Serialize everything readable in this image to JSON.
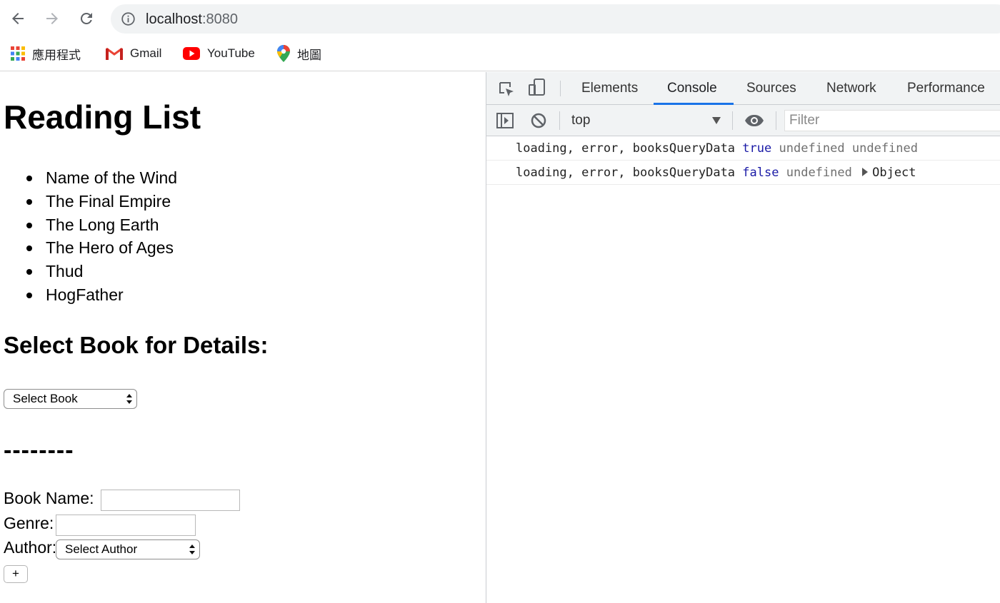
{
  "browser": {
    "url_host": "localhost",
    "url_port": ":8080",
    "bookmarks": [
      {
        "label": "應用程式",
        "icon": "apps-grid-icon"
      },
      {
        "label": "Gmail",
        "icon": "gmail-icon"
      },
      {
        "label": "YouTube",
        "icon": "youtube-icon"
      },
      {
        "label": "地圖",
        "icon": "maps-pin-icon"
      }
    ]
  },
  "page": {
    "title": "Reading List",
    "books": [
      "Name of the Wind",
      "The Final Empire",
      "The Long Earth",
      "The Hero of Ages",
      "Thud",
      "HogFather"
    ],
    "details_heading": "Select Book for Details:",
    "book_select_value": "Select Book",
    "divider_text": "--------",
    "form": {
      "book_name_label": "Book Name:",
      "book_name_value": "",
      "genre_label": "Genre:",
      "genre_value": "",
      "author_label": "Author:",
      "author_select_value": "Select Author",
      "add_button_label": "+"
    }
  },
  "devtools": {
    "tabs": [
      {
        "label": "Elements",
        "active": false
      },
      {
        "label": "Console",
        "active": true
      },
      {
        "label": "Sources",
        "active": false
      },
      {
        "label": "Network",
        "active": false
      },
      {
        "label": "Performance",
        "active": false
      }
    ],
    "context": "top",
    "filter_placeholder": "Filter",
    "console_lines": [
      {
        "message": "loading, error, booksQueryData",
        "loading": "true",
        "error": "undefined",
        "data": "undefined"
      },
      {
        "message": "loading, error, booksQueryData",
        "loading": "false",
        "error": "undefined",
        "data": "Object"
      }
    ],
    "accent_color": "#1a73e8"
  }
}
